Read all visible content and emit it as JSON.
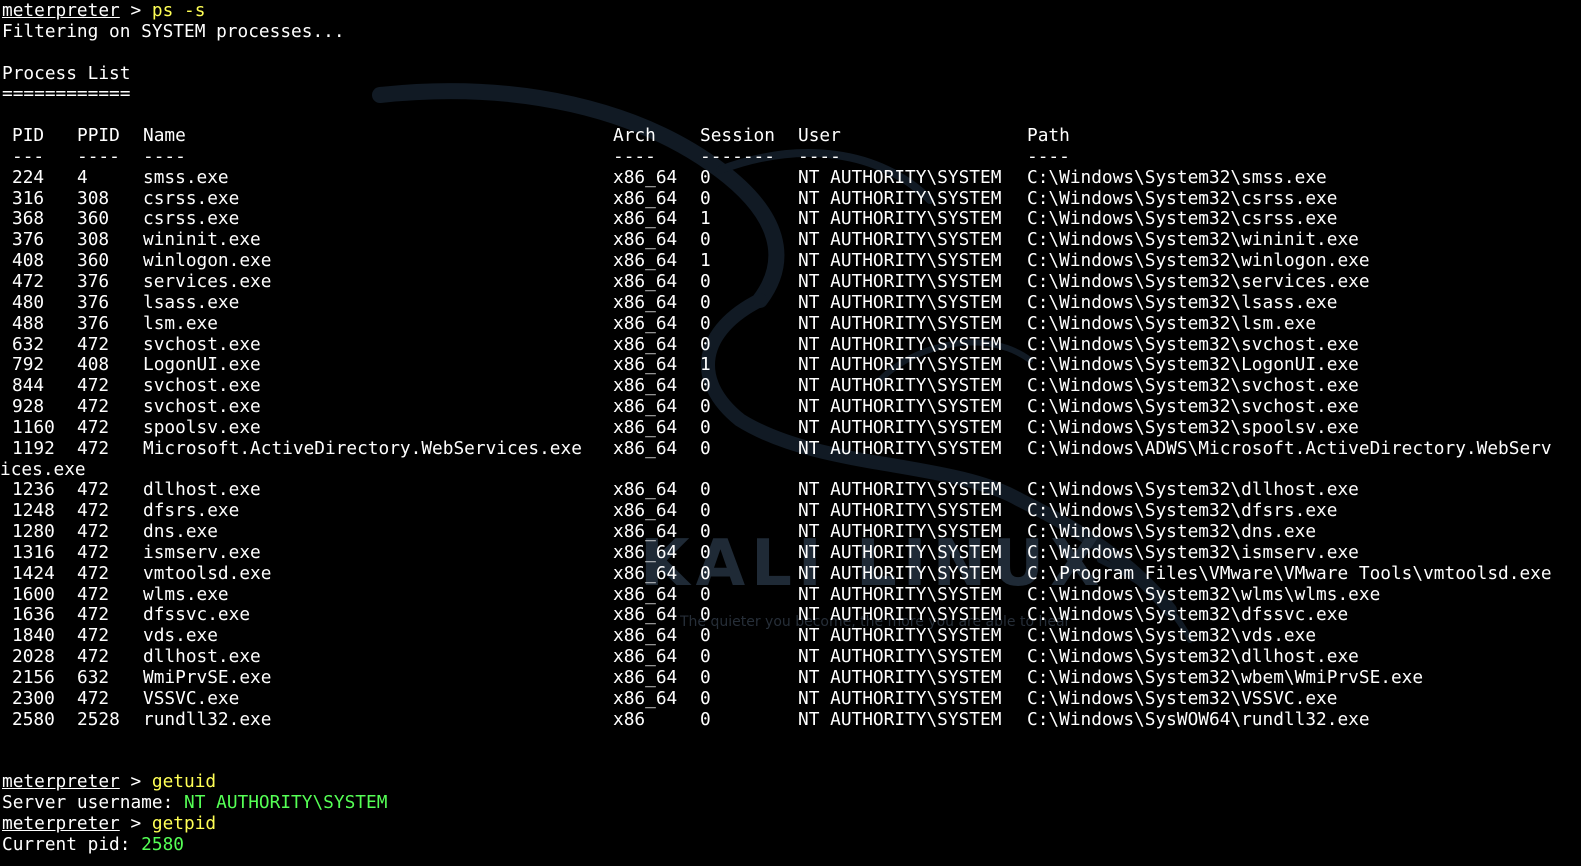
{
  "colors": {
    "background": "#000000",
    "text": "#ffffff",
    "command": "#ffff55",
    "highlight": "#55ff55"
  },
  "session": {
    "prompt": "meterpreter",
    "prompt_symbol": " > ",
    "command1": "ps -s",
    "filter_msg": "Filtering on SYSTEM processes...",
    "list_title": "Process List",
    "list_rule": "============",
    "command2": "getuid",
    "uid_label": "Server username: ",
    "uid_value": "NT AUTHORITY\\SYSTEM",
    "command3": "getpid",
    "pid_label": "Current pid: ",
    "pid_value": "2580"
  },
  "watermark": {
    "text": "KALI LINUX",
    "tagline": "The quieter you become, the more you are able to hear"
  },
  "table": {
    "headers": [
      "PID",
      "PPID",
      "Name",
      "Arch",
      "Session",
      "User",
      "Path"
    ],
    "dividers": [
      "---",
      "----",
      "----",
      "----",
      "-------",
      "----",
      "----"
    ],
    "rows": [
      [
        "224",
        "4",
        "smss.exe",
        "x86_64",
        "0",
        "NT AUTHORITY\\SYSTEM",
        "C:\\Windows\\System32\\smss.exe"
      ],
      [
        "316",
        "308",
        "csrss.exe",
        "x86_64",
        "0",
        "NT AUTHORITY\\SYSTEM",
        "C:\\Windows\\System32\\csrss.exe"
      ],
      [
        "368",
        "360",
        "csrss.exe",
        "x86_64",
        "1",
        "NT AUTHORITY\\SYSTEM",
        "C:\\Windows\\System32\\csrss.exe"
      ],
      [
        "376",
        "308",
        "wininit.exe",
        "x86_64",
        "0",
        "NT AUTHORITY\\SYSTEM",
        "C:\\Windows\\System32\\wininit.exe"
      ],
      [
        "408",
        "360",
        "winlogon.exe",
        "x86_64",
        "1",
        "NT AUTHORITY\\SYSTEM",
        "C:\\Windows\\System32\\winlogon.exe"
      ],
      [
        "472",
        "376",
        "services.exe",
        "x86_64",
        "0",
        "NT AUTHORITY\\SYSTEM",
        "C:\\Windows\\System32\\services.exe"
      ],
      [
        "480",
        "376",
        "lsass.exe",
        "x86_64",
        "0",
        "NT AUTHORITY\\SYSTEM",
        "C:\\Windows\\System32\\lsass.exe"
      ],
      [
        "488",
        "376",
        "lsm.exe",
        "x86_64",
        "0",
        "NT AUTHORITY\\SYSTEM",
        "C:\\Windows\\System32\\lsm.exe"
      ],
      [
        "632",
        "472",
        "svchost.exe",
        "x86_64",
        "0",
        "NT AUTHORITY\\SYSTEM",
        "C:\\Windows\\System32\\svchost.exe"
      ],
      [
        "792",
        "408",
        "LogonUI.exe",
        "x86_64",
        "1",
        "NT AUTHORITY\\SYSTEM",
        "C:\\Windows\\System32\\LogonUI.exe"
      ],
      [
        "844",
        "472",
        "svchost.exe",
        "x86_64",
        "0",
        "NT AUTHORITY\\SYSTEM",
        "C:\\Windows\\System32\\svchost.exe"
      ],
      [
        "928",
        "472",
        "svchost.exe",
        "x86_64",
        "0",
        "NT AUTHORITY\\SYSTEM",
        "C:\\Windows\\System32\\svchost.exe"
      ],
      [
        "1160",
        "472",
        "spoolsv.exe",
        "x86_64",
        "0",
        "NT AUTHORITY\\SYSTEM",
        "C:\\Windows\\System32\\spoolsv.exe"
      ],
      [
        "1192",
        "472",
        "Microsoft.ActiveDirectory.WebServices.exe",
        "x86_64",
        "0",
        "NT AUTHORITY\\SYSTEM",
        "C:\\Windows\\ADWS\\Microsoft.ActiveDirectory.WebServ"
      ],
      [
        "1236",
        "472",
        "dllhost.exe",
        "x86_64",
        "0",
        "NT AUTHORITY\\SYSTEM",
        "C:\\Windows\\System32\\dllhost.exe"
      ],
      [
        "1248",
        "472",
        "dfsrs.exe",
        "x86_64",
        "0",
        "NT AUTHORITY\\SYSTEM",
        "C:\\Windows\\System32\\dfsrs.exe"
      ],
      [
        "1280",
        "472",
        "dns.exe",
        "x86_64",
        "0",
        "NT AUTHORITY\\SYSTEM",
        "C:\\Windows\\System32\\dns.exe"
      ],
      [
        "1316",
        "472",
        "ismserv.exe",
        "x86_64",
        "0",
        "NT AUTHORITY\\SYSTEM",
        "C:\\Windows\\System32\\ismserv.exe"
      ],
      [
        "1424",
        "472",
        "vmtoolsd.exe",
        "x86_64",
        "0",
        "NT AUTHORITY\\SYSTEM",
        "C:\\Program Files\\VMware\\VMware Tools\\vmtoolsd.exe"
      ],
      [
        "1600",
        "472",
        "wlms.exe",
        "x86_64",
        "0",
        "NT AUTHORITY\\SYSTEM",
        "C:\\Windows\\System32\\wlms\\wlms.exe"
      ],
      [
        "1636",
        "472",
        "dfssvc.exe",
        "x86_64",
        "0",
        "NT AUTHORITY\\SYSTEM",
        "C:\\Windows\\System32\\dfssvc.exe"
      ],
      [
        "1840",
        "472",
        "vds.exe",
        "x86_64",
        "0",
        "NT AUTHORITY\\SYSTEM",
        "C:\\Windows\\System32\\vds.exe"
      ],
      [
        "2028",
        "472",
        "dllhost.exe",
        "x86_64",
        "0",
        "NT AUTHORITY\\SYSTEM",
        "C:\\Windows\\System32\\dllhost.exe"
      ],
      [
        "2156",
        "632",
        "WmiPrvSE.exe",
        "x86_64",
        "0",
        "NT AUTHORITY\\SYSTEM",
        "C:\\Windows\\System32\\wbem\\WmiPrvSE.exe"
      ],
      [
        "2300",
        "472",
        "VSSVC.exe",
        "x86_64",
        "0",
        "NT AUTHORITY\\SYSTEM",
        "C:\\Windows\\System32\\VSSVC.exe"
      ],
      [
        "2580",
        "2528",
        "rundll32.exe",
        "x86",
        "0",
        "NT AUTHORITY\\SYSTEM",
        "C:\\Windows\\SysWOW64\\rundll32.exe"
      ]
    ],
    "wrap_after_row": 13,
    "wrap_text": "ices.exe"
  }
}
